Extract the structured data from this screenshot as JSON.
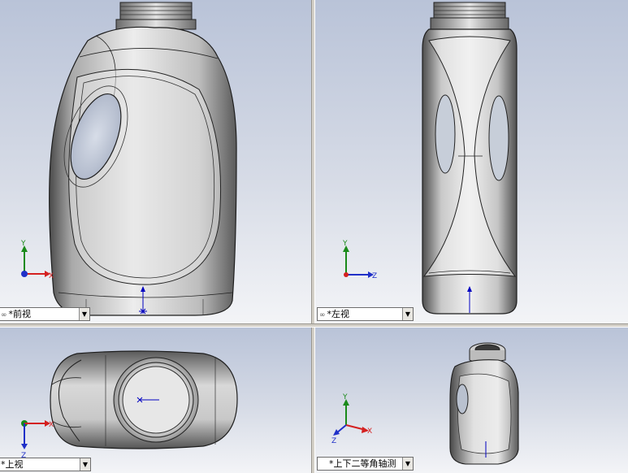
{
  "views": {
    "front": {
      "label": "*前视",
      "link_glyph": "∞"
    },
    "left": {
      "label": "*左视",
      "link_glyph": "∞"
    },
    "top": {
      "label": "*上视"
    },
    "iso": {
      "label": "*上下二等角轴测"
    }
  },
  "axes": {
    "x": "X",
    "y": "Y",
    "z": "Z"
  },
  "colors": {
    "viewport_top": "#b9c3d8",
    "viewport_bottom": "#f3f4f7",
    "axis_x": "#d42020",
    "axis_y": "#1a8a1a",
    "axis_z": "#2030c8",
    "origin_marker": "#0000c0"
  },
  "icons": {
    "dropdown": "chevron-down-icon",
    "link": "link-icon"
  }
}
